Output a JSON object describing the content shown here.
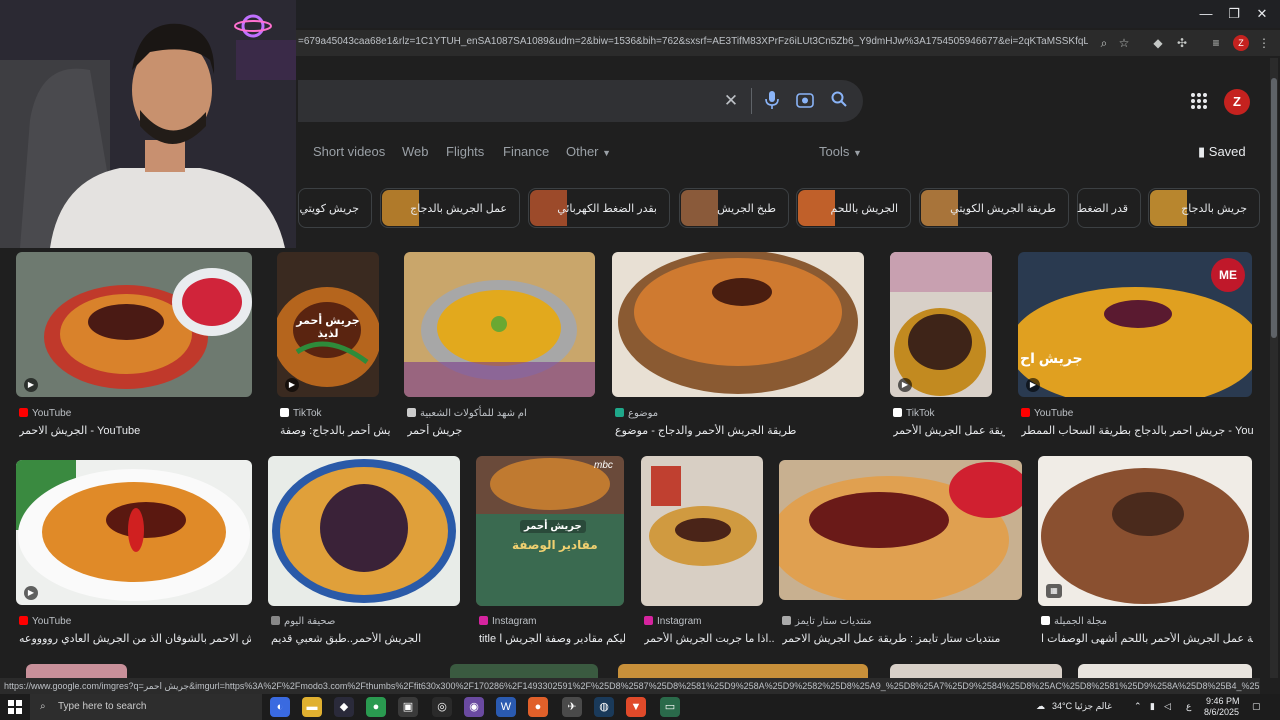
{
  "browser": {
    "url": "=679a45043caa68e1&rlz=1C1YTUH_enSA1087SA1089&udm=2&biw=1536&bih=762&sxsrf=AE3TifM83XPrFz6iLUt3Cn5Zb6_Y9dmHJw%3A1754505946677&ei=2qKTaMSSKfqLi-gP-fDImAY&v...",
    "profile_initial": "Z",
    "status_url": "https://www.google.com/imgres?q=جريش احمر&imgurl=https%3A%2F%2Fmodo3.com%2Fthumbs%2Ffit630x300%2F170286%2F1493302591%2F%25D8%2587%25D8%2581%25D9%258A%25D9%2582%25D8%25A9_%25D8%25A7%25D9%2584%25D8%25AC%25D8%2581%25D9%258A%25D8%25B4_%25D8%25A7%25D9%2584%25D8%25A3%25D8..."
  },
  "header": {
    "avatar_initial": "Z",
    "tabs": [
      "Short videos",
      "Web",
      "Flights",
      "Finance",
      "Other",
      "Tools"
    ],
    "saved_label": "Saved"
  },
  "chips": [
    "جريش كويتي",
    "عمل الجريش بالدجاج",
    "بقدر الضغط الكهربائي",
    "طبخ الجريش",
    "الجريش باللحم",
    "طريقة الجريش الكويتي",
    "قدر الضغط",
    "جريش بالدجاج"
  ],
  "results": [
    {
      "source": "YouTube",
      "title": "الجريش الاحمر - YouTube"
    },
    {
      "source": "TikTok",
      "title": "جريش أحمر بالدجاج: وصفة..."
    },
    {
      "source": "ام شهد للمأكولات الشعبية",
      "title": "جريش أحمر"
    },
    {
      "source": "موضوع",
      "title": "طريقة الجريش الأحمر والدجاج - موضوع"
    },
    {
      "source": "TikTok",
      "title": "طريقة عمل الجريش الأحمر..."
    },
    {
      "source": "YouTube",
      "title": "جريش احمر بالدجاج بطريقة السحاب الممطر - YouTube"
    },
    {
      "source": "YouTube",
      "title": "الجريش الاحمر بالشوفان الذ من الجريش العادي رووووعه..."
    },
    {
      "source": "صحيفة اليوم",
      "title": "الجريش الأحمر..طبق شعبي قديم"
    },
    {
      "source": "Instagram",
      "title": "title إليكم مقادير وصفة الجريش ا..."
    },
    {
      "source": "Instagram",
      "title": "اذا ما جربت الجريش الأحمر..."
    },
    {
      "source": "منتديات ستار تايمز",
      "title": "منتديات ستار تايمز : طريقة عمل الجريش الاحمر"
    },
    {
      "source": "مجلة الجميلة",
      "title": "طريقة عمل الجريش الأحمر باللحم أشهى الوصفات ا..."
    }
  ],
  "image_overlays": {
    "r2_text": "جريش أحمر لذيذ",
    "r6_logo": "ME",
    "r6_caption": "جريش اح",
    "r9_text": "جريش أحمر",
    "r9_subtitle": "مقادير الوصفة",
    "r9_brand": "mbc"
  },
  "taskbar": {
    "search_placeholder": "Type here to search",
    "weather": "34°C  غالم جزئيا",
    "lang": "ع",
    "time": "9:46 PM",
    "date": "8/6/2025"
  }
}
